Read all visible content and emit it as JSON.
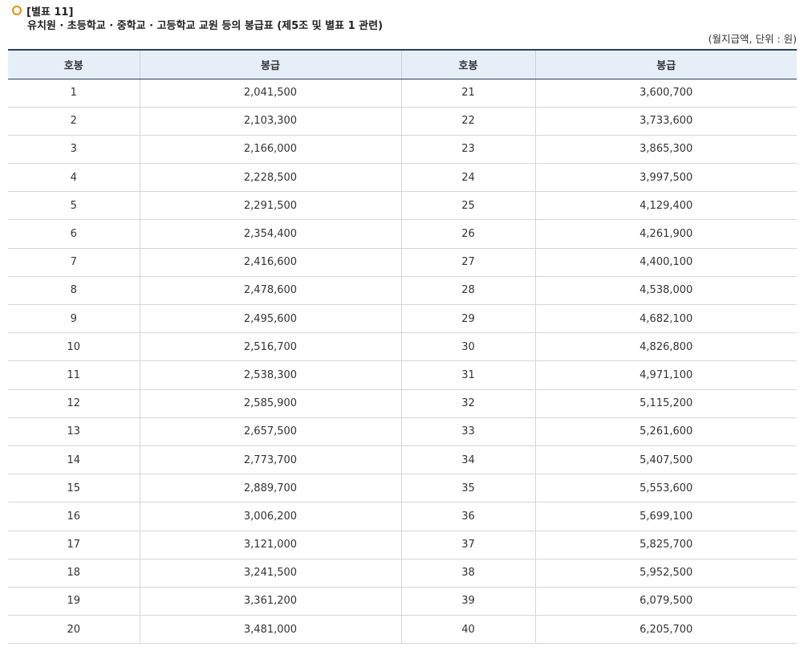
{
  "header": {
    "label": "[별표 11]",
    "title": "유치원 · 초등학교 · 중학교 · 고등학교 교원 등의 봉급표 (제5조 및 별표 1 관련)",
    "unit": "(월지급액, 단위 : 원)"
  },
  "table": {
    "headers": [
      "호봉",
      "봉급",
      "호봉",
      "봉급"
    ],
    "rows": [
      {
        "g1": "1",
        "p1": "2,041,500",
        "g2": "21",
        "p2": "3,600,700"
      },
      {
        "g1": "2",
        "p1": "2,103,300",
        "g2": "22",
        "p2": "3,733,600"
      },
      {
        "g1": "3",
        "p1": "2,166,000",
        "g2": "23",
        "p2": "3,865,300"
      },
      {
        "g1": "4",
        "p1": "2,228,500",
        "g2": "24",
        "p2": "3,997,500"
      },
      {
        "g1": "5",
        "p1": "2,291,500",
        "g2": "25",
        "p2": "4,129,400"
      },
      {
        "g1": "6",
        "p1": "2,354,400",
        "g2": "26",
        "p2": "4,261,900"
      },
      {
        "g1": "7",
        "p1": "2,416,600",
        "g2": "27",
        "p2": "4,400,100"
      },
      {
        "g1": "8",
        "p1": "2,478,600",
        "g2": "28",
        "p2": "4,538,000"
      },
      {
        "g1": "9",
        "p1": "2,495,600",
        "g2": "29",
        "p2": "4,682,100"
      },
      {
        "g1": "10",
        "p1": "2,516,700",
        "g2": "30",
        "p2": "4,826,800"
      },
      {
        "g1": "11",
        "p1": "2,538,300",
        "g2": "31",
        "p2": "4,971,100"
      },
      {
        "g1": "12",
        "p1": "2,585,900",
        "g2": "32",
        "p2": "5,115,200"
      },
      {
        "g1": "13",
        "p1": "2,657,500",
        "g2": "33",
        "p2": "5,261,600"
      },
      {
        "g1": "14",
        "p1": "2,773,700",
        "g2": "34",
        "p2": "5,407,500"
      },
      {
        "g1": "15",
        "p1": "2,889,700",
        "g2": "35",
        "p2": "5,553,600"
      },
      {
        "g1": "16",
        "p1": "3,006,200",
        "g2": "36",
        "p2": "5,699,100"
      },
      {
        "g1": "17",
        "p1": "3,121,000",
        "g2": "37",
        "p2": "5,825,700"
      },
      {
        "g1": "18",
        "p1": "3,241,500",
        "g2": "38",
        "p2": "5,952,500"
      },
      {
        "g1": "19",
        "p1": "3,361,200",
        "g2": "39",
        "p2": "6,079,500"
      },
      {
        "g1": "20",
        "p1": "3,481,000",
        "g2": "40",
        "p2": "6,205,700"
      }
    ]
  }
}
